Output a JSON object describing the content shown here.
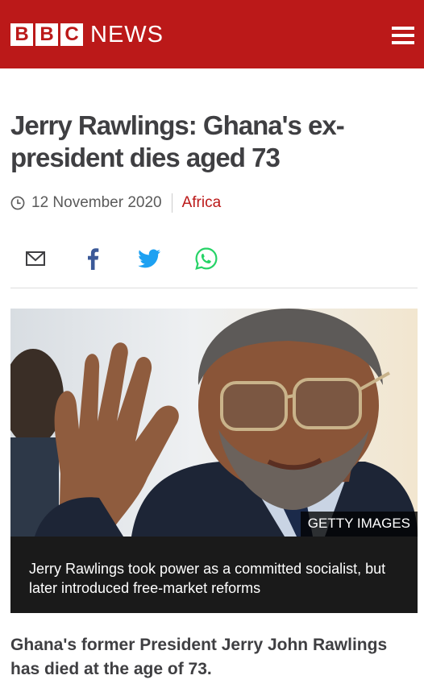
{
  "header": {
    "logo_letters": [
      "B",
      "B",
      "C"
    ],
    "brand_word": "NEWS",
    "menu_icon": "hamburger-icon",
    "background_color": "#bb1919"
  },
  "article": {
    "headline": "Jerry Rawlings: Ghana's ex-president dies aged 73",
    "date": "12 November 2020",
    "topic": "Africa",
    "topic_color": "#bb1919",
    "share_icons": [
      "email-icon",
      "facebook-icon",
      "twitter-icon",
      "whatsapp-icon"
    ],
    "image_credit": "GETTY IMAGES",
    "caption": "Jerry Rawlings took power as a committed socialist, but later introduced free-market reforms",
    "lead": "Ghana's former President Jerry John Rawlings has died at the age of 73."
  }
}
